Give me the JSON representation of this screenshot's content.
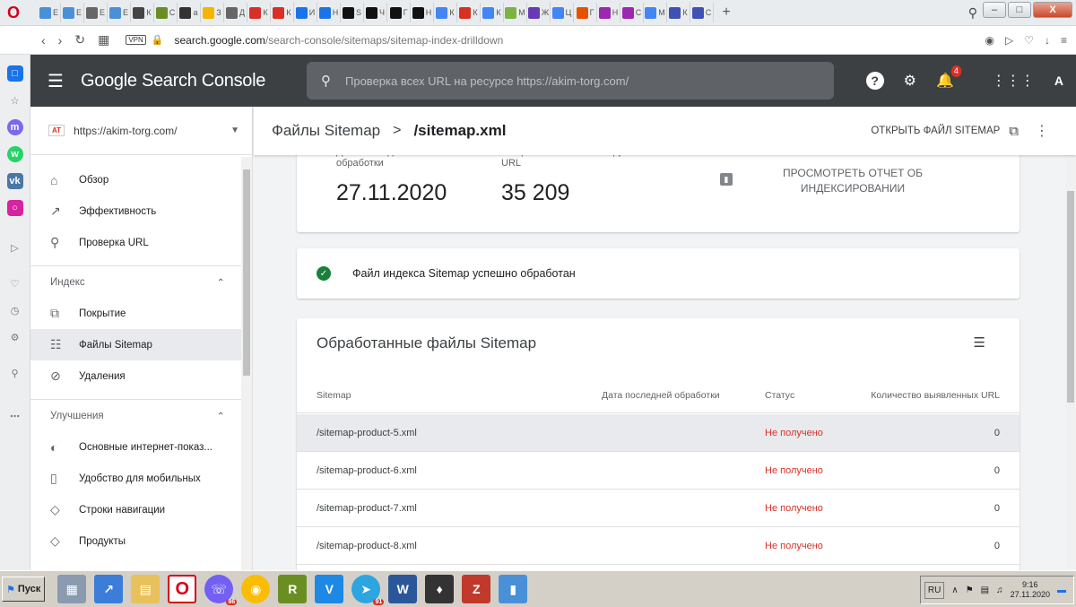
{
  "browser": {
    "tabs": [
      "Е",
      "Е",
      "Е",
      "Е",
      "К",
      "С",
      "а",
      "З",
      "Д",
      "К",
      "К",
      "И",
      "Н",
      "S",
      "Ч",
      "Г",
      "Н",
      "К",
      "К",
      "К",
      "М",
      "Ж",
      "Ц",
      "Г",
      "Н",
      "С",
      "М",
      "К",
      "С"
    ],
    "url_domain": "search.google.com",
    "url_path": "/search-console/sitemaps/sitemap-index-drilldown",
    "vpn_label": "VPN"
  },
  "header": {
    "product_title": "Google Search Console",
    "search_placeholder": "Проверка всех URL на ресурсе https://akim-torg.com/",
    "notifications_count": "4",
    "account_initial": "A"
  },
  "nav": {
    "property": "https://akim-torg.com/",
    "property_badge": "AT",
    "items_top": [
      {
        "label": "Обзор",
        "icon": "home-icon"
      },
      {
        "label": "Эффективность",
        "icon": "trending-icon"
      },
      {
        "label": "Проверка URL",
        "icon": "search-icon"
      }
    ],
    "section_index": "Индекс",
    "items_index": [
      {
        "label": "Покрытие",
        "icon": "coverage-icon"
      },
      {
        "label": "Файлы Sitemap",
        "icon": "sitemap-icon"
      },
      {
        "label": "Удаления",
        "icon": "removals-icon"
      }
    ],
    "section_enhancements": "Улучшения",
    "items_enh": [
      {
        "label": "Основные интернет-показ...",
        "icon": "speed-icon"
      },
      {
        "label": "Удобство для мобильных",
        "icon": "mobile-icon"
      },
      {
        "label": "Строки навигации",
        "icon": "layers-icon"
      },
      {
        "label": "Продукты",
        "icon": "layers-icon"
      }
    ]
  },
  "page": {
    "breadcrumb_parent": "Файлы Sitemap",
    "breadcrumb_sep": ">",
    "breadcrumb_current": "/sitemap.xml",
    "open_file": "ОТКРЫТЬ ФАЙЛ SITEMAP"
  },
  "stats": {
    "last_processed_label": "Дата последней обработки",
    "last_processed_value": "27.11.2020",
    "total_urls_label": "Общее количество обнаруженных URL",
    "total_urls_value": "35 209",
    "report_link": "ПРОСМОТРЕТЬ ОТЧЕТ ОБ ИНДЕКСИРОВАНИИ"
  },
  "status_message": "Файл индекса Sitemap успешно обработан",
  "table": {
    "title": "Обработанные файлы Sitemap",
    "columns": [
      "Sitemap",
      "Дата последней обработки",
      "Статус",
      "Количество выявленных URL"
    ],
    "rows": [
      {
        "sitemap": "/sitemap-product-5.xml",
        "date": "",
        "status": "Не получено",
        "count": "0"
      },
      {
        "sitemap": "/sitemap-product-6.xml",
        "date": "",
        "status": "Не получено",
        "count": "0"
      },
      {
        "sitemap": "/sitemap-product-7.xml",
        "date": "",
        "status": "Не получено",
        "count": "0"
      },
      {
        "sitemap": "/sitemap-product-8.xml",
        "date": "",
        "status": "Не получено",
        "count": "0"
      }
    ]
  },
  "taskbar": {
    "start_label": "Пуск",
    "viber_count": "86",
    "telegram_count": "91",
    "lang": "RU",
    "time": "9:16",
    "date": "27.11.2020"
  },
  "colors": {
    "header_bg": "#3c4043",
    "status_error": "#d93025",
    "status_ok": "#188038"
  }
}
